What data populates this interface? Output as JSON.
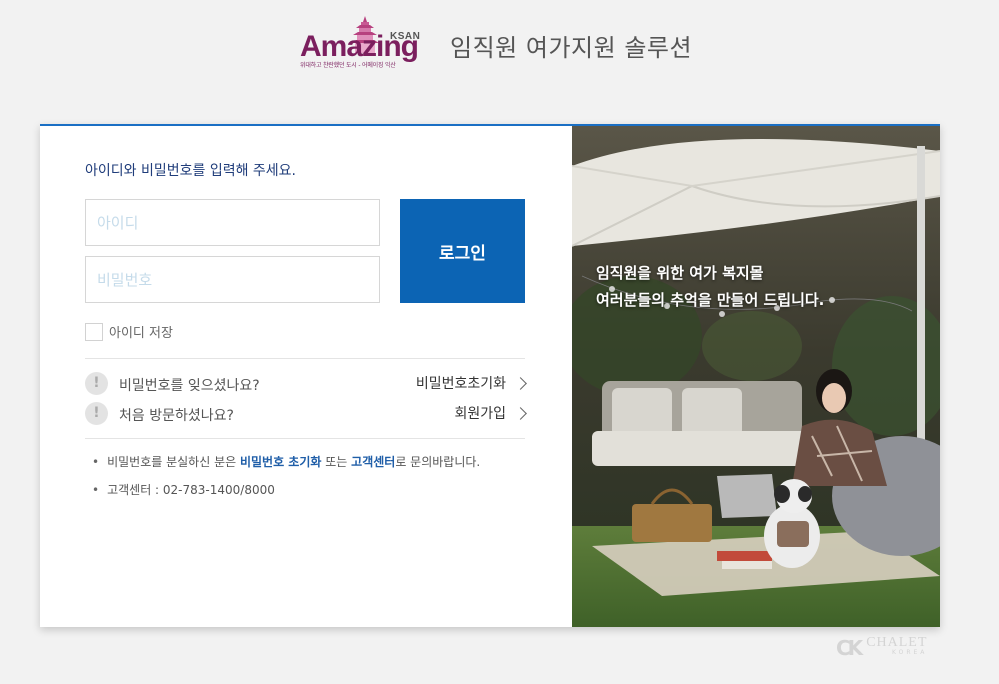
{
  "header": {
    "logo": {
      "main": "Amazing",
      "ksan": "KSAN",
      "sub": "위대하고 찬란했던 도시 - 어메이징 익산"
    },
    "title": "임직원 여가지원 솔루션"
  },
  "login": {
    "intro": "아이디와 비밀번호를 입력해 주세요.",
    "id_placeholder": "아이디",
    "password_placeholder": "비밀번호",
    "login_label": "로그인",
    "remember_label": "아이디 저장"
  },
  "help": [
    {
      "question": "비밀번호를 잊으셨나요?",
      "link": "비밀번호초기화"
    },
    {
      "question": "처음 방문하셨나요?",
      "link": "회원가입"
    }
  ],
  "notes": {
    "note1_prefix": "비밀번호를 분실하신 분은 ",
    "note1_link1": "비밀번호 초기화",
    "note1_mid": " 또는 ",
    "note1_link2": "고객센터",
    "note1_suffix": "로 문의바랍니다.",
    "note2": "고객센터 : 02-783-1400/8000"
  },
  "promo": {
    "line1": "임직원을 위한 여가 복지몰",
    "line2": "여러분들의 추억을 만들어 드립니다."
  },
  "watermark": {
    "main": "CHALET",
    "sub": "KOREA"
  },
  "colors": {
    "accent": "#0c64b4",
    "brand": "#7b1f5e",
    "link": "#1f5ea8",
    "intro_text": "#1f3c7a"
  }
}
